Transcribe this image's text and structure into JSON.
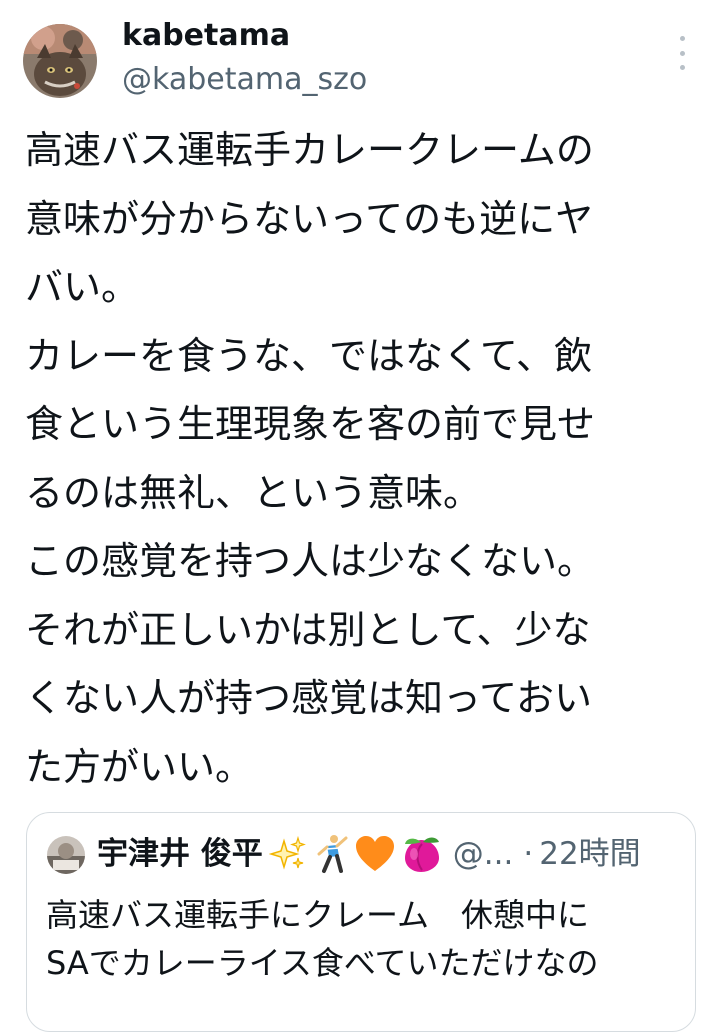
{
  "author": {
    "display_name": "kabetama",
    "handle": "@kabetama_szo",
    "avatar_icon": "cat-photo-avatar"
  },
  "tweet": {
    "lines": [
      "高速バス運転手カレークレームの",
      "意味が分からないってのも逆にヤ",
      "バい。",
      "カレーを食うな、ではなくて、飲",
      "食という生理現象を客の前で見せ",
      "るのは無礼、という意味。",
      "この感覚を持つ人は少なくない。",
      "それが正しいかは別として、少な",
      "くない人が持つ感覚は知っておい",
      "た方がいい。"
    ]
  },
  "quote": {
    "display_name": "宇津井 俊平",
    "emojis": [
      "sparkles-icon",
      "dancer-icon",
      "orange-heart-icon",
      "peach-icon"
    ],
    "handle": "@...",
    "separator": "·",
    "time": "22時間",
    "lines": [
      "高速バス運転手にクレーム　休憩中に",
      "SAでカレーライス食べていただけなの"
    ]
  },
  "colors": {
    "text": "#0f1419",
    "secondary": "#536471",
    "border": "#d6dce0",
    "sparkle": "#f2b400",
    "heart": "#ff8c1a",
    "peach": "#e0199a"
  }
}
